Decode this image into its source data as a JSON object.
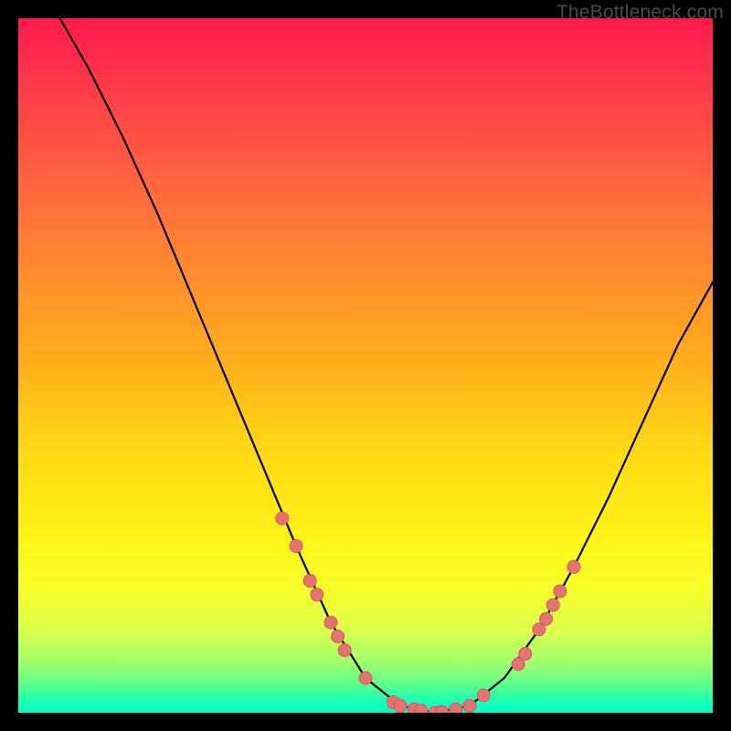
{
  "watermark": "TheBottleneck.com",
  "colors": {
    "background": "#000000",
    "curve_stroke": "#000000",
    "marker_fill": "#e57373",
    "marker_stroke": "#d85a5a"
  },
  "chart_data": {
    "type": "line",
    "title": "",
    "xlabel": "",
    "ylabel": "",
    "xlim": [
      0,
      100
    ],
    "ylim": [
      0,
      100
    ],
    "grid": false,
    "legend": false,
    "curve": [
      {
        "x": 6,
        "y": 100
      },
      {
        "x": 10,
        "y": 93
      },
      {
        "x": 15,
        "y": 83
      },
      {
        "x": 20,
        "y": 72
      },
      {
        "x": 25,
        "y": 60
      },
      {
        "x": 30,
        "y": 48
      },
      {
        "x": 35,
        "y": 36
      },
      {
        "x": 40,
        "y": 24
      },
      {
        "x": 45,
        "y": 13
      },
      {
        "x": 50,
        "y": 5
      },
      {
        "x": 55,
        "y": 1
      },
      {
        "x": 60,
        "y": 0
      },
      {
        "x": 65,
        "y": 1
      },
      {
        "x": 70,
        "y": 5
      },
      {
        "x": 75,
        "y": 12
      },
      {
        "x": 80,
        "y": 21
      },
      {
        "x": 85,
        "y": 31
      },
      {
        "x": 90,
        "y": 42
      },
      {
        "x": 95,
        "y": 53
      },
      {
        "x": 100,
        "y": 62
      }
    ],
    "markers": [
      {
        "x": 38,
        "y": 28
      },
      {
        "x": 40,
        "y": 24
      },
      {
        "x": 42,
        "y": 19
      },
      {
        "x": 43,
        "y": 17
      },
      {
        "x": 45,
        "y": 13
      },
      {
        "x": 46,
        "y": 11
      },
      {
        "x": 47,
        "y": 9
      },
      {
        "x": 50,
        "y": 5
      },
      {
        "x": 54,
        "y": 1.5
      },
      {
        "x": 55,
        "y": 1
      },
      {
        "x": 57,
        "y": 0.5
      },
      {
        "x": 58,
        "y": 0.3
      },
      {
        "x": 60,
        "y": 0
      },
      {
        "x": 61,
        "y": 0.1
      },
      {
        "x": 63,
        "y": 0.5
      },
      {
        "x": 65,
        "y": 1
      },
      {
        "x": 67,
        "y": 2.5
      },
      {
        "x": 72,
        "y": 7
      },
      {
        "x": 73,
        "y": 8.5
      },
      {
        "x": 75,
        "y": 12
      },
      {
        "x": 76,
        "y": 13.5
      },
      {
        "x": 77,
        "y": 15.5
      },
      {
        "x": 78,
        "y": 17.5
      },
      {
        "x": 80,
        "y": 21
      }
    ]
  }
}
